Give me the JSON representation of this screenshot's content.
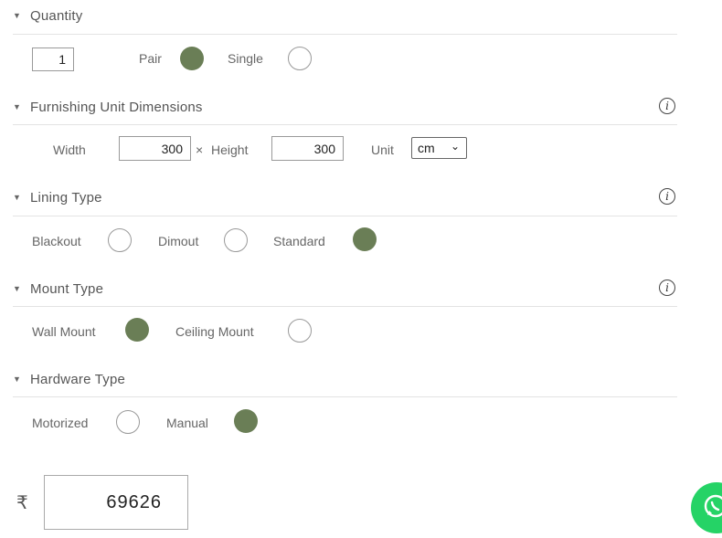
{
  "sections": {
    "quantity": {
      "title": "Quantity",
      "value": "1",
      "options": [
        "Pair",
        "Single"
      ],
      "selected": "Pair"
    },
    "dimensions": {
      "title": "Furnishing Unit Dimensions",
      "width_label": "Width",
      "width_value": "300",
      "times": "×",
      "height_label": "Height",
      "height_value": "300",
      "unit_label": "Unit",
      "unit_value": "cm"
    },
    "lining": {
      "title": "Lining Type",
      "options": [
        "Blackout",
        "Dimout",
        "Standard"
      ],
      "selected": "Standard"
    },
    "mount": {
      "title": "Mount Type",
      "options": [
        "Wall Mount",
        "Ceiling Mount"
      ],
      "selected": "Wall Mount"
    },
    "hardware": {
      "title": "Hardware Type",
      "options": [
        "Motorized",
        "Manual"
      ],
      "selected": "Manual"
    }
  },
  "price": {
    "currency": "₹",
    "value": "69626"
  },
  "icons": {
    "chevron": "chevron-down-icon",
    "info": "info-icon",
    "whatsapp": "whatsapp-icon"
  },
  "colors": {
    "selected": "#6a7e56",
    "whatsapp": "#25d366"
  }
}
